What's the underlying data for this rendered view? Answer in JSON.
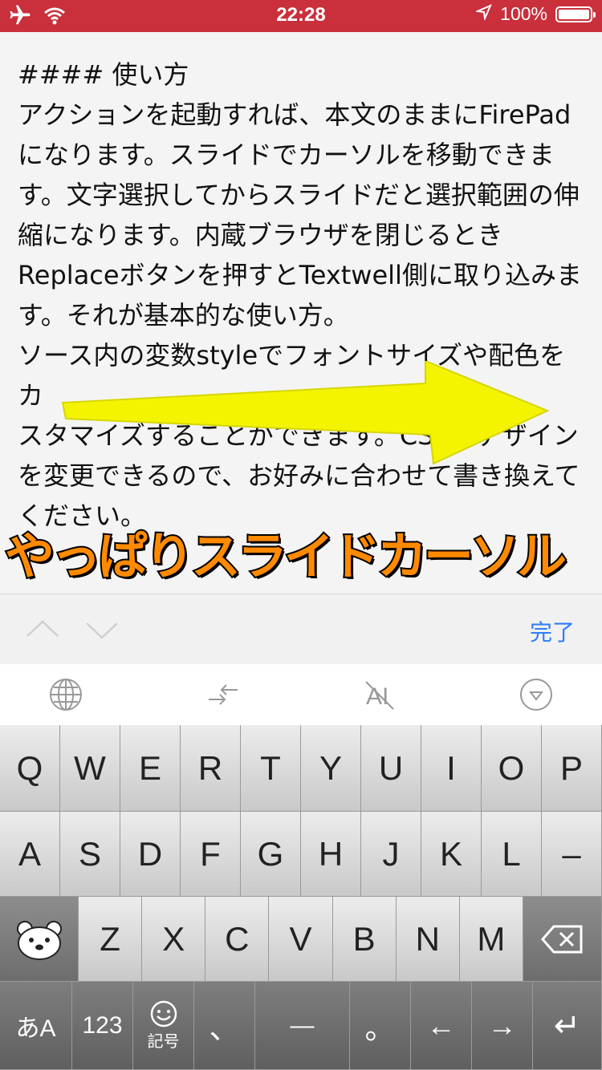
{
  "status_bar": {
    "time": "22:28",
    "battery_percent": "100%",
    "battery_level": 1.0,
    "icons": [
      "airplane-icon",
      "wifi-icon",
      "location-arrow-icon",
      "battery-icon"
    ]
  },
  "editor": {
    "lines": [
      "#### 使い方",
      "アクションを起動すれば、本文のままにFirePad",
      "になります。スライドでカーソルを移動できま",
      "す。文字選択してからスライドだと選択範囲の伸",
      "縮になります。内蔵ブラウザを閉じるとき",
      "Replaceボタンを押すとTextwell側に取り込みま",
      "す。それが基本的な使い方。",
      "ソース内の変数styleでフォントサイズや配色をカ",
      "スタマイズすることができます。CSSでデザイン",
      "を変更できるので、お好みに合わせて書き換えて",
      "ください。"
    ]
  },
  "banner": {
    "text": "やっぱりスライドカーソル"
  },
  "accessory": {
    "done_label": "完了",
    "accent_color": "#2e7cf6"
  },
  "toolbar": {
    "icons": [
      "globe-icon",
      "cursor-arrows-icon",
      "font-off-icon",
      "dismiss-keyboard-icon"
    ]
  },
  "keyboard": {
    "row1": [
      "Q",
      "W",
      "E",
      "R",
      "T",
      "Y",
      "U",
      "I",
      "O",
      "P"
    ],
    "row2": [
      "A",
      "S",
      "D",
      "F",
      "G",
      "H",
      "J",
      "K",
      "L",
      "–"
    ],
    "row3": [
      "Z",
      "X",
      "C",
      "V",
      "B",
      "N",
      "M"
    ],
    "bottom": {
      "kana_label": "あA",
      "num_label": "123",
      "symbol_label": "記号",
      "comma": "、",
      "space": "—",
      "period": "。",
      "left_arrow": "←",
      "right_arrow": "→",
      "return": "↵"
    }
  }
}
